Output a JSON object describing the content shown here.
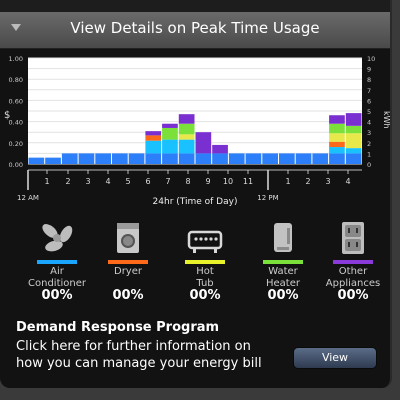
{
  "header": {
    "title": "View Details on Peak Time Usage"
  },
  "chart_data": {
    "type": "bar",
    "stacked": true,
    "left_axis": {
      "label": "$",
      "ticks": [
        "1.00",
        "0.80",
        "0.60",
        "0.40",
        "0.20",
        "0.00"
      ],
      "ylim": [
        0,
        1.0
      ]
    },
    "right_axis": {
      "label": "kWh",
      "ticks": [
        "10",
        "9",
        "8",
        "7",
        "6",
        "5",
        "4",
        "3",
        "2",
        "1",
        "0"
      ],
      "ylim": [
        0,
        10
      ]
    },
    "xlabel": "24hr (Time of Day)",
    "x_tick_labels": [
      "1",
      "2",
      "3",
      "4",
      "5",
      "6",
      "7",
      "8",
      "9",
      "10",
      "11",
      "1",
      "2",
      "3",
      "4"
    ],
    "markers": [
      "12 AM",
      "12 PM"
    ],
    "colors": {
      "base": "#2d7ff9",
      "cyan": "#19c2ff",
      "orange": "#ff6a1a",
      "yellow": "#e7e84a",
      "green": "#7be03a",
      "purple": "#7a2fd0"
    },
    "series": [
      {
        "name": "base",
        "values": [
          0.6,
          0.6,
          1,
          1,
          1,
          1,
          1,
          1,
          1,
          1,
          1,
          1,
          1,
          1,
          1,
          1,
          1,
          1,
          1,
          1
        ]
      },
      {
        "name": "cyan",
        "values": [
          0,
          0,
          0,
          0,
          0,
          0,
          0,
          1.2,
          1.3,
          1.3,
          0,
          0,
          0,
          0,
          0,
          0,
          0,
          0,
          0.6,
          0.5
        ]
      },
      {
        "name": "orange",
        "values": [
          0,
          0,
          0,
          0,
          0,
          0,
          0,
          0.5,
          0,
          0,
          0,
          0,
          0,
          0,
          0,
          0,
          0,
          0,
          0.5,
          0
        ]
      },
      {
        "name": "yellow",
        "values": [
          0,
          0,
          0,
          0,
          0,
          0,
          0,
          0,
          0,
          0.5,
          0,
          0,
          0,
          0,
          0,
          0,
          0,
          0,
          0.8,
          1.4
        ]
      },
      {
        "name": "green",
        "values": [
          0,
          0,
          0,
          0,
          0,
          0,
          0,
          0,
          1.1,
          1.0,
          0,
          0,
          0,
          0,
          0,
          0,
          0,
          0,
          0.9,
          0.7
        ]
      },
      {
        "name": "purple",
        "values": [
          0,
          0,
          0,
          0,
          0,
          0,
          0,
          0.4,
          0.4,
          0.9,
          2.0,
          0.8,
          0,
          0,
          0,
          0,
          0,
          0,
          0.8,
          1.2
        ]
      }
    ]
  },
  "categories": [
    {
      "label_line1": "Air",
      "label_line2": "Conditioner",
      "value": "00%",
      "color": "#1aa6ff",
      "icon": "fan-icon"
    },
    {
      "label_line1": "Dryer",
      "label_line2": "",
      "value": "00%",
      "color": "#ff6a1a",
      "icon": "dryer-icon"
    },
    {
      "label_line1": "Hot",
      "label_line2": "Tub",
      "value": "00%",
      "color": "#e8f22a",
      "icon": "hot-tub-icon"
    },
    {
      "label_line1": "Water",
      "label_line2": "Heater",
      "value": "00%",
      "color": "#7be03a",
      "icon": "water-heater-icon"
    },
    {
      "label_line1": "Other",
      "label_line2": "Appliances",
      "value": "00%",
      "color": "#8a3ad8",
      "icon": "outlet-icon"
    }
  ],
  "demand_response": {
    "title": "Demand Response Program",
    "line1": "Click here for further information on",
    "line2": "how you can manage your energy bill",
    "button_label": "View"
  }
}
